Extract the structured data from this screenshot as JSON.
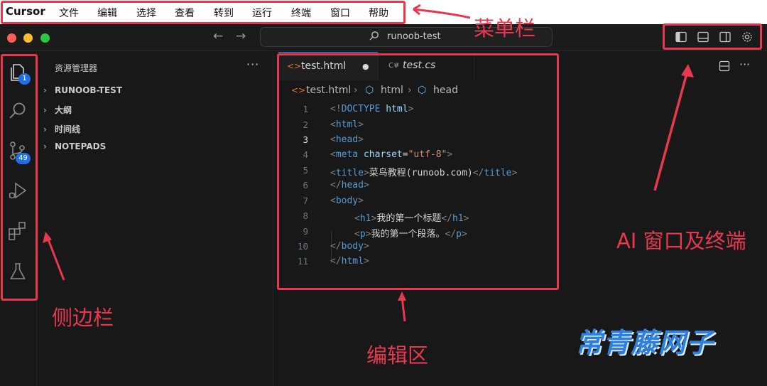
{
  "menubar": {
    "app_name": "Cursor",
    "items": [
      "文件",
      "编辑",
      "选择",
      "查看",
      "转到",
      "运行",
      "终端",
      "窗口",
      "帮助"
    ]
  },
  "titlebar": {
    "back_icon": "arrow-left-icon",
    "forward_icon": "arrow-right-icon",
    "search_text": "runoob-test",
    "layout_icons": [
      "toggle-primary-sidebar-icon",
      "toggle-panel-icon",
      "toggle-secondary-sidebar-icon",
      "settings-gear-icon"
    ],
    "traffic_colors": [
      "#ff5f57",
      "#febc2e",
      "#28c840"
    ]
  },
  "activity_bar": {
    "items": [
      {
        "icon": "explorer-files-icon",
        "badge": "1"
      },
      {
        "icon": "search-icon",
        "badge": ""
      },
      {
        "icon": "source-control-icon",
        "badge": "49"
      },
      {
        "icon": "run-debug-icon",
        "badge": ""
      },
      {
        "icon": "extensions-icon",
        "badge": ""
      },
      {
        "icon": "testing-flask-icon",
        "badge": ""
      }
    ]
  },
  "sidebar": {
    "title": "资源管理器",
    "more": "···",
    "sections": [
      "RUNOOB-TEST",
      "大纲",
      "时间线",
      "NOTEPADS"
    ]
  },
  "editor": {
    "tabs": [
      {
        "label": "test.html",
        "icon": "<>",
        "dirty": "●",
        "active": true
      },
      {
        "label": "test.cs",
        "icon": "C#",
        "dirty": "",
        "active": false
      }
    ],
    "breadcrumb": [
      "test.html",
      "html",
      "head"
    ],
    "line_numbers": [
      "1",
      "2",
      "3",
      "4",
      "5",
      "6",
      "7",
      "8",
      "9",
      "10",
      "11"
    ],
    "current_line": "3",
    "code": {
      "l1_a": "<!",
      "l1_b": "DOCTYPE",
      "l1_c": " html",
      "l1_d": ">",
      "l2_open": "<",
      "l2_tag": "html",
      "l2_close": ">",
      "l3_open": "<",
      "l3_tag": "head",
      "l3_close": ">",
      "l4_open": "<",
      "l4_tag": "meta",
      "l4_attr": " charset",
      "l4_eq": "=",
      "l4_val": "\"utf-8\"",
      "l4_close": ">",
      "l5_open": "<",
      "l5_tag": "title",
      "l5_close": ">",
      "l5_text": "菜鸟教程(runoob.com)",
      "l5_end_open": "</",
      "l5_end_tag": "title",
      "l5_end_close": ">",
      "l6_open": "</",
      "l6_tag": "head",
      "l6_close": ">",
      "l7_open": "<",
      "l7_tag": "body",
      "l7_close": ">",
      "l8_open": "<",
      "l8_tag": "h1",
      "l8_close": ">",
      "l8_text": "我的第一个标题",
      "l8_end_open": "</",
      "l8_end_tag": "h1",
      "l8_end_close": ">",
      "l9_open": "<",
      "l9_tag": "p",
      "l9_close": ">",
      "l9_text": "我的第一个段落。",
      "l9_end_open": "</",
      "l9_end_tag": "p",
      "l9_end_close": ">",
      "l10_open": "</",
      "l10_tag": "body",
      "l10_close": ">",
      "l11_open": "</",
      "l11_tag": "html",
      "l11_close": ">"
    },
    "split_icon": "split-editor-icon",
    "more": "···"
  },
  "annotations": {
    "menu": "菜单栏",
    "ai": "AI 窗口及终端",
    "sidebar": "侧边栏",
    "editor": "编辑区",
    "color": "#e8384f"
  },
  "watermark": "常青藤网子"
}
